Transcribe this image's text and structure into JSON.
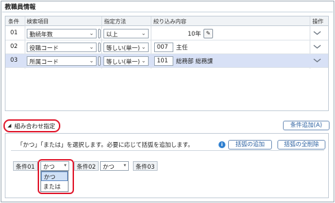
{
  "title": "教職員情報",
  "grid": {
    "headers": {
      "condition": "条件",
      "field": "検索項目",
      "method": "指定方法",
      "content": "絞り込み内容",
      "op": "操作"
    },
    "rows": [
      {
        "num": "01",
        "field": "勤続年数",
        "method": "以上",
        "value": "10年"
      },
      {
        "num": "02",
        "field": "役職コード",
        "method": "等しい(単一)",
        "code": "007",
        "value": "主任"
      },
      {
        "num": "03",
        "field": "所属コード",
        "method": "等しい(単一)",
        "code": "101",
        "value": "総務部 総務課"
      }
    ]
  },
  "combination": {
    "toggle_label": "組み合わせ指定",
    "add_condition": "条件追加(A)",
    "description": "「かつ」「または」を選択します。必要に応じて括弧を追加します。",
    "add_paren": "括弧の追加",
    "delete_parens": "括弧の全削除",
    "cond1": "条件01",
    "op1": "かつ",
    "cond2": "条件02",
    "op2": "かつ",
    "cond3": "条件03",
    "options": [
      "かつ",
      "または"
    ]
  },
  "icons": {
    "pencil": "pencil-icon",
    "info": "info-icon",
    "chevron": "chevron-down-icon",
    "triangle": "triangle-toggle-icon"
  },
  "colors": {
    "highlight": "#e0162b",
    "selected_row": "#d8e1f6",
    "accent": "#2a5fa0"
  }
}
